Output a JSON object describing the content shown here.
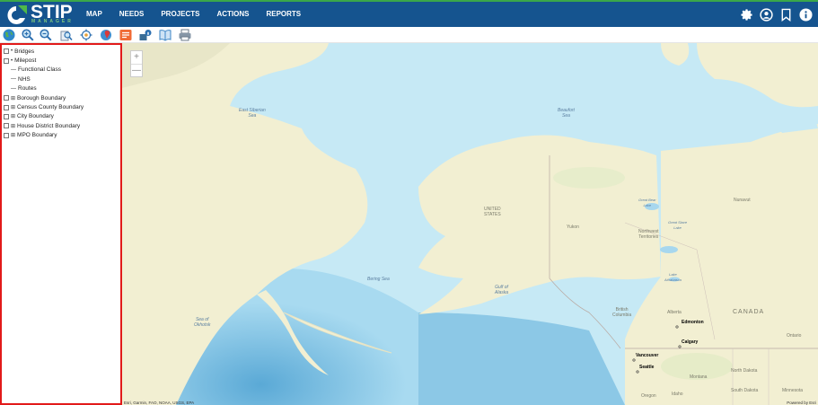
{
  "app": {
    "logo_text": "STIP",
    "logo_subtext": "MANAGER"
  },
  "nav": {
    "items": [
      "MAP",
      "NEEDS",
      "PROJECTS",
      "ACTIONS",
      "REPORTS"
    ]
  },
  "top_icons": [
    "gear-icon",
    "user-circle-icon",
    "bookmark-icon",
    "info-icon"
  ],
  "toolbar": {
    "tools": [
      "globe-icon",
      "zoom-in-icon",
      "zoom-out-icon",
      "zoom-layer-icon",
      "locate-icon",
      "map-pin-icon",
      "list-icon",
      "identify-icon",
      "book-icon",
      "print-icon"
    ]
  },
  "layers": [
    {
      "label": "Bridges",
      "symbol": "•",
      "checkbox": true
    },
    {
      "label": "Milepost",
      "symbol": "•",
      "checkbox": true
    },
    {
      "label": "Functional Class",
      "symbol": "—",
      "checkbox": false
    },
    {
      "label": "NHS",
      "symbol": "—",
      "checkbox": false
    },
    {
      "label": "Routes",
      "symbol": "—",
      "checkbox": false
    },
    {
      "label": "Borough Boundary",
      "symbol": "⊞",
      "checkbox": true
    },
    {
      "label": "Census County Boundary",
      "symbol": "⊞",
      "checkbox": true
    },
    {
      "label": "City Boundary",
      "symbol": "⊞",
      "checkbox": true
    },
    {
      "label": "House District Boundary",
      "symbol": "⊞",
      "checkbox": true
    },
    {
      "label": "MPO Boundary",
      "symbol": "⊞",
      "checkbox": true
    }
  ],
  "map": {
    "zoom_in": "+",
    "zoom_out": "—",
    "water_labels": {
      "east_siberian": "East Siberian\nSea",
      "beaufort": "Beaufort\nSea",
      "bering": "Bering Sea",
      "gulf_alaska": "Gulf of\nAlaska",
      "okhotsk": "Sea of\nOkhotsk"
    },
    "land_labels": {
      "united_states": "UNITED\nSTATES",
      "yukon": "Yukon",
      "northwest": "Northwest\nTerritories",
      "nunavut": "Nunavut",
      "british_columbia": "British\nColumbia",
      "alberta": "Alberta",
      "canada": "CANADA",
      "ontario": "Ontario",
      "great_bear": "Great Bear\nLake",
      "great_slave": "Great Slave\nLake",
      "athabasca": "Lake\nAthabasca",
      "montana": "Montana",
      "north_dakota": "North Dakota",
      "south_dakota": "South Dakota",
      "oregon": "Oregon",
      "idaho": "Idaho",
      "minnesota": "Minnesota"
    },
    "cities": {
      "edmonton": "Edmonton",
      "calgary": "Calgary",
      "vancouver": "Vancouver",
      "seattle": "Seattle"
    },
    "attribution": "Esri, Garmin, FAO, NOAA, USGS, EPA",
    "powered_by": "Powered by Esri"
  }
}
